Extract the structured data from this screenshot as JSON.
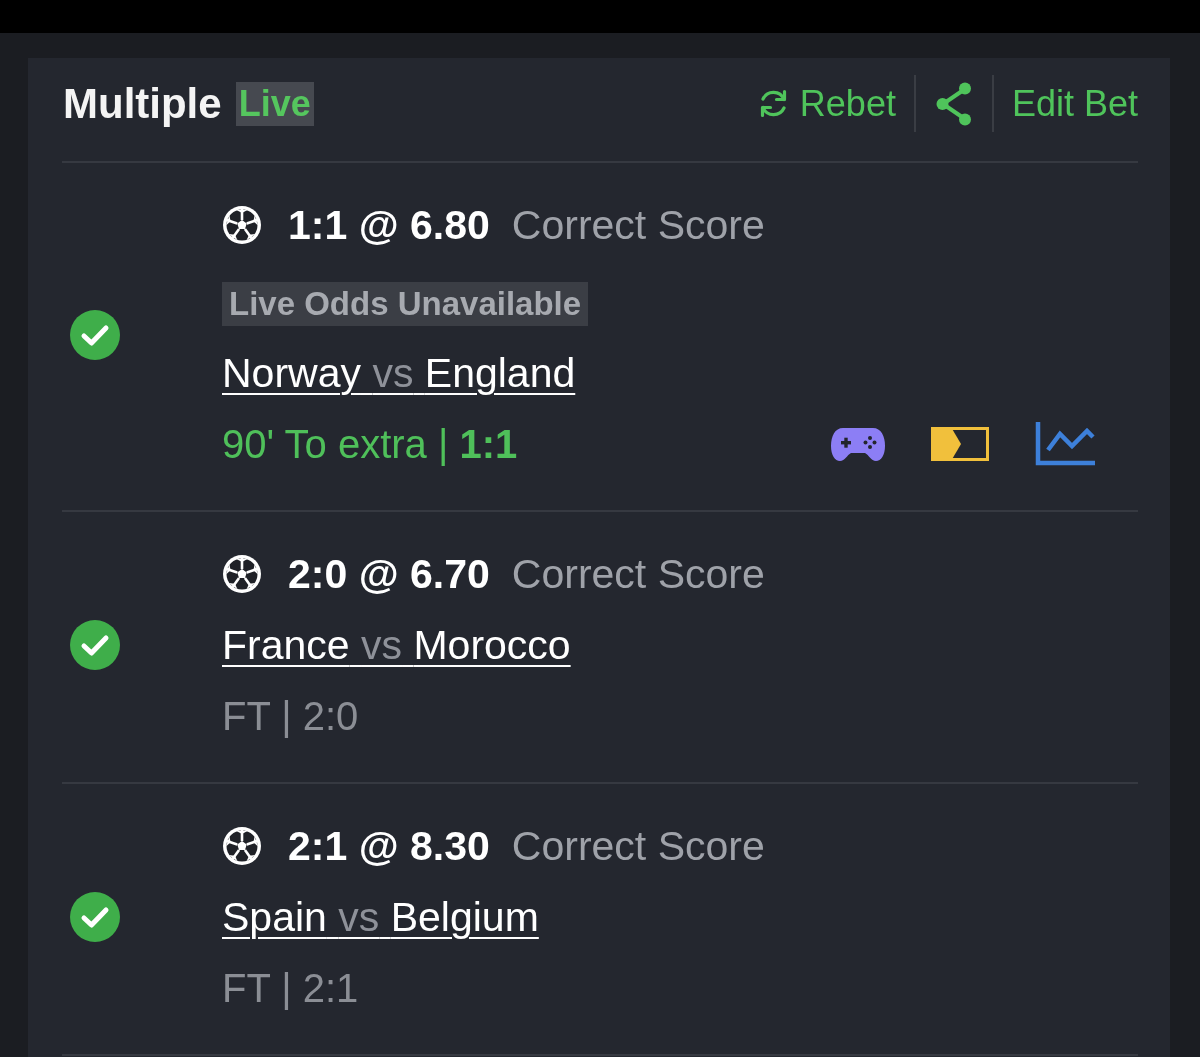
{
  "header": {
    "title": "Multiple",
    "badge": "Live",
    "actions": [
      {
        "kind": "rebet",
        "label": "Rebet"
      },
      {
        "kind": "share"
      },
      {
        "kind": "edit",
        "label": "Edit Bet"
      }
    ]
  },
  "selections": [
    {
      "won": true,
      "pick": "1:1 @ 6.80",
      "market": "Correct Score",
      "notice": "Live Odds Unavailable",
      "home": "Norway",
      "vs": "vs",
      "away": "England",
      "status": "90' To extra | **1:1**",
      "live": true,
      "extras": [
        {
          "kind": "game"
        },
        {
          "kind": "stream"
        },
        {
          "kind": "stats"
        }
      ]
    },
    {
      "won": true,
      "pick": "2:0 @ 6.70",
      "market": "Correct Score",
      "home": "France",
      "vs": "vs",
      "away": "Morocco",
      "status": "FT | 2:0",
      "live": false
    },
    {
      "won": true,
      "pick": "2:1 @ 8.30",
      "market": "Correct Score",
      "home": "Spain",
      "vs": "vs",
      "away": "Belgium",
      "status": "FT | 2:1",
      "live": false
    }
  ]
}
